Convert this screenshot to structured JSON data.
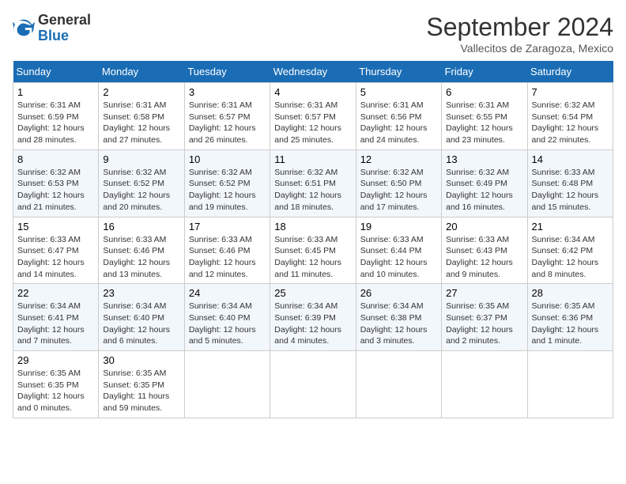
{
  "header": {
    "logo_line1": "General",
    "logo_line2": "Blue",
    "month_title": "September 2024",
    "subtitle": "Vallecitos de Zaragoza, Mexico"
  },
  "days_of_week": [
    "Sunday",
    "Monday",
    "Tuesday",
    "Wednesday",
    "Thursday",
    "Friday",
    "Saturday"
  ],
  "weeks": [
    [
      {
        "day": "1",
        "info": "Sunrise: 6:31 AM\nSunset: 6:59 PM\nDaylight: 12 hours\nand 28 minutes."
      },
      {
        "day": "2",
        "info": "Sunrise: 6:31 AM\nSunset: 6:58 PM\nDaylight: 12 hours\nand 27 minutes."
      },
      {
        "day": "3",
        "info": "Sunrise: 6:31 AM\nSunset: 6:57 PM\nDaylight: 12 hours\nand 26 minutes."
      },
      {
        "day": "4",
        "info": "Sunrise: 6:31 AM\nSunset: 6:57 PM\nDaylight: 12 hours\nand 25 minutes."
      },
      {
        "day": "5",
        "info": "Sunrise: 6:31 AM\nSunset: 6:56 PM\nDaylight: 12 hours\nand 24 minutes."
      },
      {
        "day": "6",
        "info": "Sunrise: 6:31 AM\nSunset: 6:55 PM\nDaylight: 12 hours\nand 23 minutes."
      },
      {
        "day": "7",
        "info": "Sunrise: 6:32 AM\nSunset: 6:54 PM\nDaylight: 12 hours\nand 22 minutes."
      }
    ],
    [
      {
        "day": "8",
        "info": "Sunrise: 6:32 AM\nSunset: 6:53 PM\nDaylight: 12 hours\nand 21 minutes."
      },
      {
        "day": "9",
        "info": "Sunrise: 6:32 AM\nSunset: 6:52 PM\nDaylight: 12 hours\nand 20 minutes."
      },
      {
        "day": "10",
        "info": "Sunrise: 6:32 AM\nSunset: 6:52 PM\nDaylight: 12 hours\nand 19 minutes."
      },
      {
        "day": "11",
        "info": "Sunrise: 6:32 AM\nSunset: 6:51 PM\nDaylight: 12 hours\nand 18 minutes."
      },
      {
        "day": "12",
        "info": "Sunrise: 6:32 AM\nSunset: 6:50 PM\nDaylight: 12 hours\nand 17 minutes."
      },
      {
        "day": "13",
        "info": "Sunrise: 6:32 AM\nSunset: 6:49 PM\nDaylight: 12 hours\nand 16 minutes."
      },
      {
        "day": "14",
        "info": "Sunrise: 6:33 AM\nSunset: 6:48 PM\nDaylight: 12 hours\nand 15 minutes."
      }
    ],
    [
      {
        "day": "15",
        "info": "Sunrise: 6:33 AM\nSunset: 6:47 PM\nDaylight: 12 hours\nand 14 minutes."
      },
      {
        "day": "16",
        "info": "Sunrise: 6:33 AM\nSunset: 6:46 PM\nDaylight: 12 hours\nand 13 minutes."
      },
      {
        "day": "17",
        "info": "Sunrise: 6:33 AM\nSunset: 6:46 PM\nDaylight: 12 hours\nand 12 minutes."
      },
      {
        "day": "18",
        "info": "Sunrise: 6:33 AM\nSunset: 6:45 PM\nDaylight: 12 hours\nand 11 minutes."
      },
      {
        "day": "19",
        "info": "Sunrise: 6:33 AM\nSunset: 6:44 PM\nDaylight: 12 hours\nand 10 minutes."
      },
      {
        "day": "20",
        "info": "Sunrise: 6:33 AM\nSunset: 6:43 PM\nDaylight: 12 hours\nand 9 minutes."
      },
      {
        "day": "21",
        "info": "Sunrise: 6:34 AM\nSunset: 6:42 PM\nDaylight: 12 hours\nand 8 minutes."
      }
    ],
    [
      {
        "day": "22",
        "info": "Sunrise: 6:34 AM\nSunset: 6:41 PM\nDaylight: 12 hours\nand 7 minutes."
      },
      {
        "day": "23",
        "info": "Sunrise: 6:34 AM\nSunset: 6:40 PM\nDaylight: 12 hours\nand 6 minutes."
      },
      {
        "day": "24",
        "info": "Sunrise: 6:34 AM\nSunset: 6:40 PM\nDaylight: 12 hours\nand 5 minutes."
      },
      {
        "day": "25",
        "info": "Sunrise: 6:34 AM\nSunset: 6:39 PM\nDaylight: 12 hours\nand 4 minutes."
      },
      {
        "day": "26",
        "info": "Sunrise: 6:34 AM\nSunset: 6:38 PM\nDaylight: 12 hours\nand 3 minutes."
      },
      {
        "day": "27",
        "info": "Sunrise: 6:35 AM\nSunset: 6:37 PM\nDaylight: 12 hours\nand 2 minutes."
      },
      {
        "day": "28",
        "info": "Sunrise: 6:35 AM\nSunset: 6:36 PM\nDaylight: 12 hours\nand 1 minute."
      }
    ],
    [
      {
        "day": "29",
        "info": "Sunrise: 6:35 AM\nSunset: 6:35 PM\nDaylight: 12 hours\nand 0 minutes."
      },
      {
        "day": "30",
        "info": "Sunrise: 6:35 AM\nSunset: 6:35 PM\nDaylight: 11 hours\nand 59 minutes."
      },
      null,
      null,
      null,
      null,
      null
    ]
  ]
}
